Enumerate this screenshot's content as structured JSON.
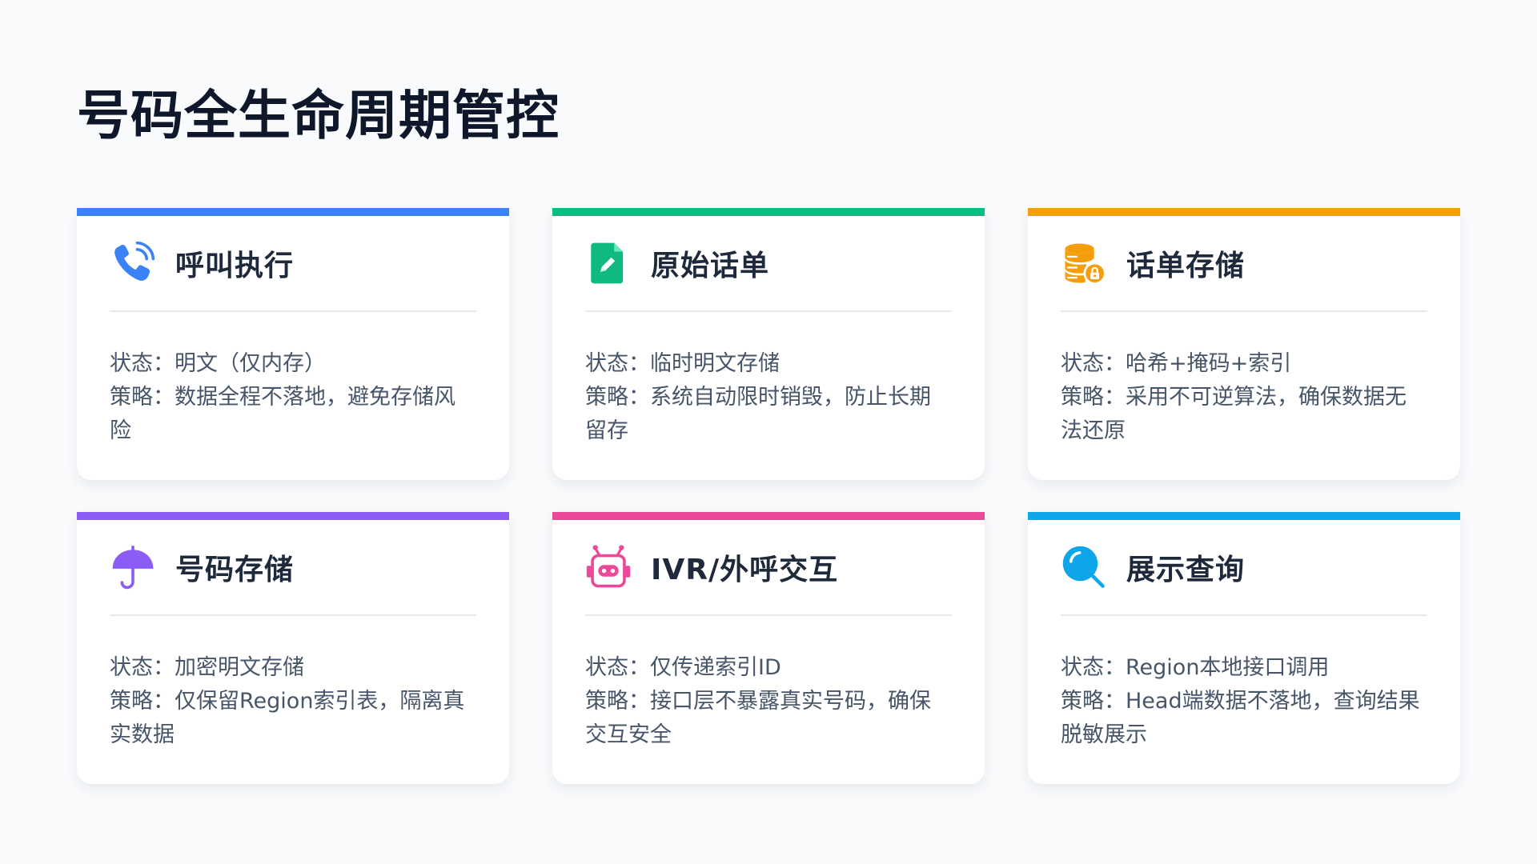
{
  "page": {
    "title": "号码全生命周期管控"
  },
  "cards": [
    {
      "title": "呼叫执行",
      "status_label": "状态：",
      "status": "明文（仅内存）",
      "strategy_label": "策略：",
      "strategy": "数据全程不落地，避免存储风险",
      "accent": "#3b82f6",
      "icon": "phone-call-icon"
    },
    {
      "title": "原始话单",
      "status_label": "状态：",
      "status": "临时明文存储",
      "strategy_label": "策略：",
      "strategy": "系统自动限时销毁，防止长期留存",
      "accent": "#10b981",
      "icon": "file-edit-icon"
    },
    {
      "title": "话单存储",
      "status_label": "状态：",
      "status": "哈希+掩码+索引",
      "strategy_label": "策略：",
      "strategy": "采用不可逆算法，确保数据无法还原",
      "accent": "#f59e0b",
      "icon": "database-lock-icon"
    },
    {
      "title": "号码存储",
      "status_label": "状态：",
      "status": "加密明文存储",
      "strategy_label": "策略：",
      "strategy": "仅保留Region索引表，隔离真实数据",
      "accent": "#8b5cf6",
      "icon": "umbrella-icon"
    },
    {
      "title": "IVR/外呼交互",
      "status_label": "状态：",
      "status": "仅传递索引ID",
      "strategy_label": "策略：",
      "strategy": "接口层不暴露真实号码，确保交互安全",
      "accent": "#ec4899",
      "icon": "robot-icon"
    },
    {
      "title": "展示查询",
      "status_label": "状态：",
      "status": "Region本地接口调用",
      "strategy_label": "策略：",
      "strategy": "Head端数据不落地，查询结果脱敏展示",
      "accent": "#0ea5e9",
      "icon": "search-icon"
    }
  ]
}
